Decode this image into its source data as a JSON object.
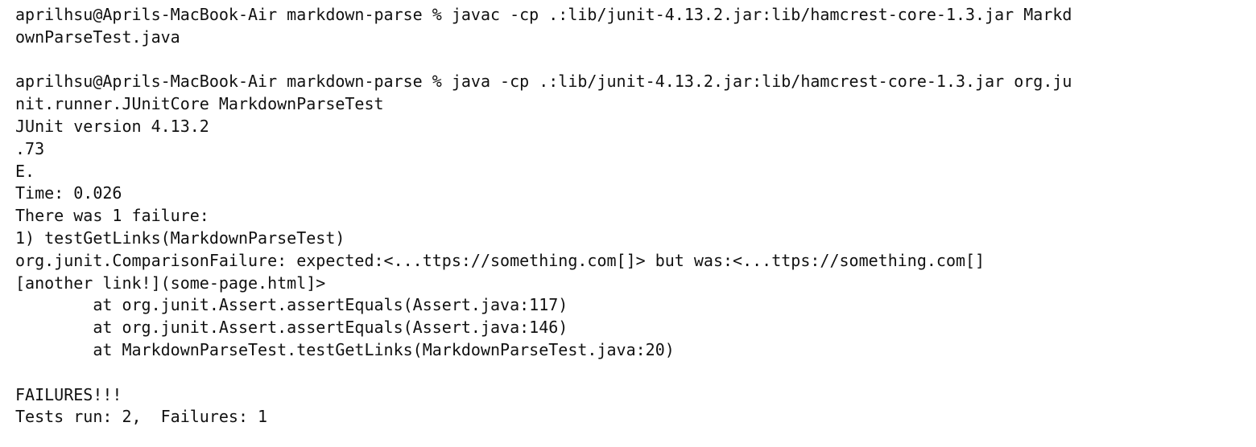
{
  "terminal": {
    "lines": [
      "aprilhsu@Aprils-MacBook-Air markdown-parse % javac -cp .:lib/junit-4.13.2.jar:lib/hamcrest-core-1.3.jar Markd",
      "ownParseTest.java",
      "",
      "aprilhsu@Aprils-MacBook-Air markdown-parse % java -cp .:lib/junit-4.13.2.jar:lib/hamcrest-core-1.3.jar org.ju",
      "nit.runner.JUnitCore MarkdownParseTest",
      "JUnit version 4.13.2",
      ".73",
      "E.",
      "Time: 0.026",
      "There was 1 failure:",
      "1) testGetLinks(MarkdownParseTest)",
      "org.junit.ComparisonFailure: expected:<...ttps://something.com[]> but was:<...ttps://something.com[]",
      "[another link!](some-page.html]>",
      "        at org.junit.Assert.assertEquals(Assert.java:117)",
      "        at org.junit.Assert.assertEquals(Assert.java:146)",
      "        at MarkdownParseTest.testGetLinks(MarkdownParseTest.java:20)",
      "",
      "FAILURES!!!",
      "Tests run: 2,  Failures: 1"
    ]
  }
}
